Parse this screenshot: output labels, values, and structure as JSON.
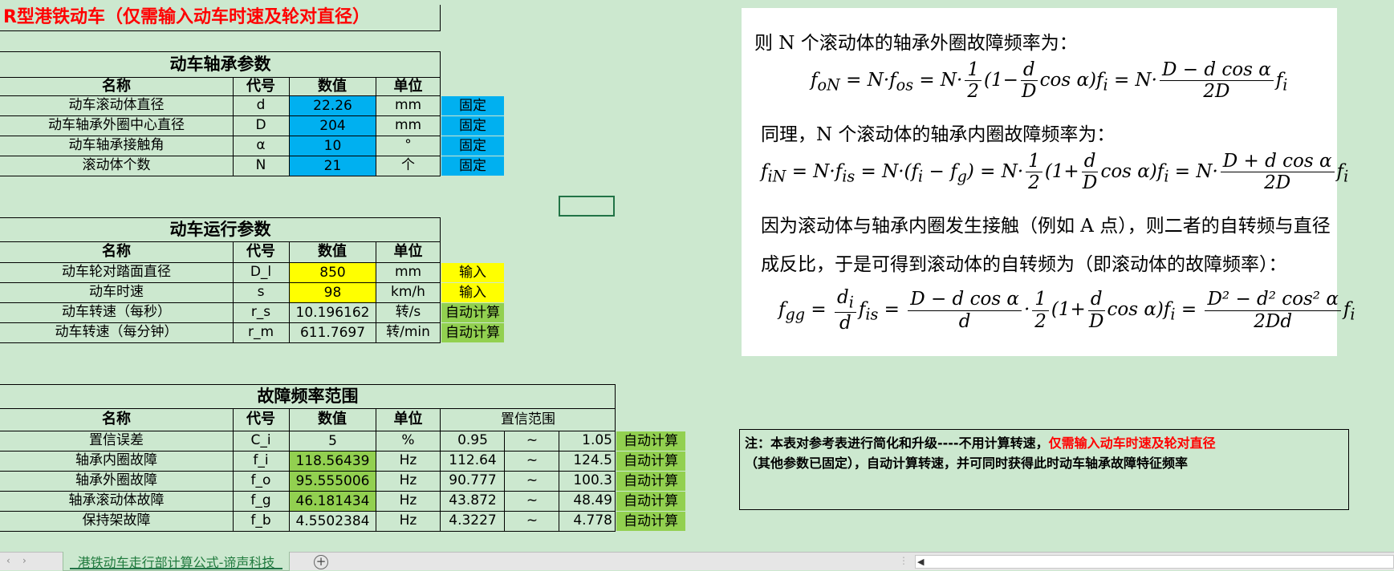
{
  "sheet_title": "R型港铁动车（仅需输入动车时速及轮对直径）",
  "bearing": {
    "section_title": "动车轴承参数",
    "headers": [
      "名称",
      "代号",
      "数值",
      "单位"
    ],
    "rows": [
      {
        "name": "动车滚动体直径",
        "code": "d",
        "value": "22.26",
        "unit": "mm",
        "tag": "固定"
      },
      {
        "name": "动车轴承外圈中心直径",
        "code": "D",
        "value": "204",
        "unit": "mm",
        "tag": "固定"
      },
      {
        "name": "动车轴承接触角",
        "code": "α",
        "value": "10",
        "unit": "°",
        "tag": "固定"
      },
      {
        "name": "滚动体个数",
        "code": "N",
        "value": "21",
        "unit": "个",
        "tag": "固定"
      }
    ]
  },
  "operation": {
    "section_title": "动车运行参数",
    "headers": [
      "名称",
      "代号",
      "数值",
      "单位"
    ],
    "rows": [
      {
        "name": "动车轮对踏面直径",
        "code": "D_l",
        "value": "850",
        "unit": "mm",
        "tag": "输入"
      },
      {
        "name": "动车时速",
        "code": "s",
        "value": "98",
        "unit": "km/h",
        "tag": "输入"
      },
      {
        "name": "动车转速（每秒）",
        "code": "r_s",
        "value": "10.196162",
        "unit": "转/s",
        "tag": "自动计算"
      },
      {
        "name": "动车转速（每分钟）",
        "code": "r_m",
        "value": "611.7697",
        "unit": "转/min",
        "tag": "自动计算"
      }
    ]
  },
  "fault": {
    "section_title": "故障频率范围",
    "headers": [
      "名称",
      "代号",
      "数值",
      "单位",
      "置信范围"
    ],
    "rows": [
      {
        "name": "置信误差",
        "code": "C_i",
        "value": "5",
        "unit": "%",
        "low": "0.95",
        "sep": "~",
        "high": "1.05",
        "tag": "自动计算"
      },
      {
        "name": "轴承内圈故障",
        "code": "f_i",
        "value": "118.56439",
        "unit": "Hz",
        "low": "112.64",
        "sep": "~",
        "high": "124.5",
        "tag": "自动计算"
      },
      {
        "name": "轴承外圈故障",
        "code": "f_o",
        "value": "95.555006",
        "unit": "Hz",
        "low": "90.777",
        "sep": "~",
        "high": "100.3",
        "tag": "自动计算"
      },
      {
        "name": "轴承滚动体故障",
        "code": "f_g",
        "value": "46.181434",
        "unit": "Hz",
        "low": "43.872",
        "sep": "~",
        "high": "48.49",
        "tag": "自动计算"
      },
      {
        "name": "保持架故障",
        "code": "f_b",
        "value": "4.5502384",
        "unit": "Hz",
        "low": "4.3227",
        "sep": "~",
        "high": "4.778",
        "tag": "自动计算"
      }
    ]
  },
  "formula_panel": {
    "line1": "则 N 个滚动体的轴承外圈故障频率为：",
    "line2": "同理，N 个滚动体的轴承内圈故障频率为：",
    "line3": "因为滚动体与轴承内圈发生接触（例如 A 点），则二者的自转频与直径",
    "line4": "成反比，于是可得到滚动体的自转频为（即滚动体的故障频率）："
  },
  "note": {
    "prefix": "注：本表对参考表进行简化和升级----不用计算转速，",
    "highlight": "仅需输入动车时速及轮对直径",
    "suffix": "（其他参数已固定），自动计算转速，并可同时获得此时动车轴承故障特征频率"
  },
  "tabs": {
    "active": "港铁动车走行部计算公式-谛声科技"
  },
  "colors": {
    "background": "#cce8cf",
    "fixed": "#00b0f0",
    "input": "#ffff00",
    "auto": "#92d050",
    "title_red": "#ff0000"
  }
}
